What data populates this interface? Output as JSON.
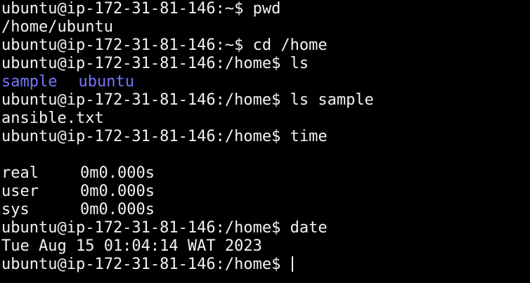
{
  "lines": {
    "l1": "ubuntu@ip-172-31-81-146:~$ pwd",
    "l2": "/home/ubuntu",
    "l3": "ubuntu@ip-172-31-81-146:~$ cd /home",
    "l4": "ubuntu@ip-172-31-81-146:/home$ ls",
    "l5_dir1": "sample",
    "l5_dir2": "ubuntu",
    "l6": "ubuntu@ip-172-31-81-146:/home$ ls sample",
    "l7": "ansible.txt",
    "l8": "ubuntu@ip-172-31-81-146:/home$ time",
    "real_label": "real",
    "real_value": "0m0.000s",
    "user_label": "user",
    "user_value": "0m0.000s",
    "sys_label": "sys",
    "sys_value": "0m0.000s",
    "l13": "ubuntu@ip-172-31-81-146:/home$ date",
    "l14": "Tue Aug 15 01:04:14 WAT 2023",
    "prompt": "ubuntu@ip-172-31-81-146:/home$ "
  },
  "colors": {
    "background": "#000000",
    "foreground": "#f2f2f2",
    "directory": "#7676ff"
  }
}
